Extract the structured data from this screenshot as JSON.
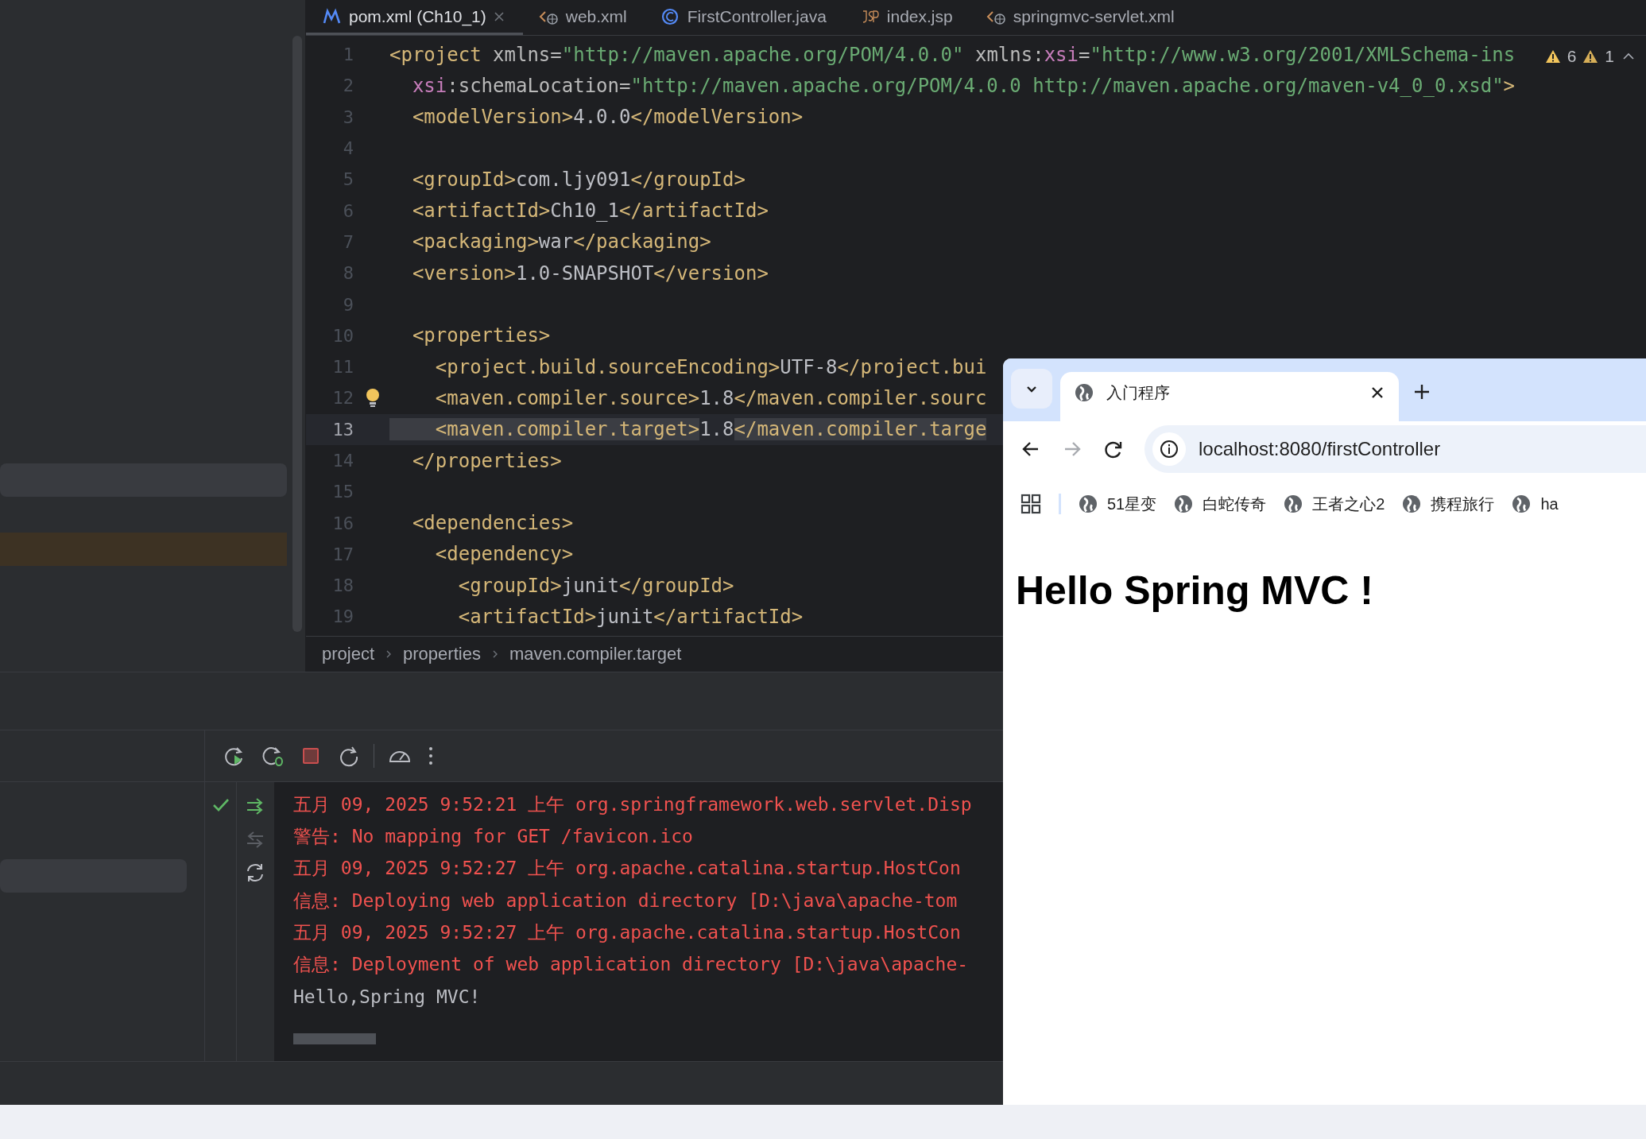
{
  "editor_tabs": [
    {
      "label": "pom.xml (Ch10_1)",
      "kind": "maven",
      "selected": true,
      "closable": true
    },
    {
      "label": "web.xml",
      "kind": "xml",
      "selected": false,
      "closable": false
    },
    {
      "label": "FirstController.java",
      "kind": "java",
      "selected": false,
      "closable": false
    },
    {
      "label": "index.jsp",
      "kind": "jsp",
      "selected": false,
      "closable": false
    },
    {
      "label": "springmvc-servlet.xml",
      "kind": "xml",
      "selected": false,
      "closable": false
    }
  ],
  "inspection": {
    "warnings": "6",
    "weak_warnings": "1"
  },
  "code_lines": [
    {
      "number": "1",
      "current": false,
      "bulb": false,
      "tokens": [
        {
          "kind": "tag",
          "text": "<project "
        },
        {
          "kind": "attr",
          "text": "xmlns="
        },
        {
          "kind": "str",
          "text": "\"http://maven.apache.org/POM/4.0.0\""
        },
        {
          "kind": "attr",
          "text": " xmlns:"
        },
        {
          "kind": "ns",
          "text": "xsi"
        },
        {
          "kind": "attr",
          "text": "="
        },
        {
          "kind": "str",
          "text": "\"http://www.w3.org/2001/XMLSchema-ins"
        }
      ]
    },
    {
      "number": "2",
      "current": false,
      "bulb": false,
      "tokens": [
        {
          "kind": "ns",
          "text": "  xsi"
        },
        {
          "kind": "attr",
          "text": ":schemaLocation="
        },
        {
          "kind": "str",
          "text": "\"http://maven.apache.org/POM/4.0.0 http://maven.apache.org/maven-v4_0_0.xsd\""
        },
        {
          "kind": "tag",
          "text": ">"
        }
      ]
    },
    {
      "number": "3",
      "current": false,
      "bulb": false,
      "tokens": [
        {
          "kind": "tag",
          "text": "  <modelVersion>"
        },
        {
          "kind": "text",
          "text": "4.0.0"
        },
        {
          "kind": "tag",
          "text": "</modelVersion>"
        }
      ]
    },
    {
      "number": "4",
      "current": false,
      "bulb": false
    },
    {
      "number": "5",
      "current": false,
      "bulb": false,
      "tokens": [
        {
          "kind": "tag",
          "text": "  <groupId>"
        },
        {
          "kind": "text",
          "text": "com.ljy091"
        },
        {
          "kind": "tag",
          "text": "</groupId>"
        }
      ]
    },
    {
      "number": "6",
      "current": false,
      "bulb": false,
      "tokens": [
        {
          "kind": "tag",
          "text": "  <artifactId>"
        },
        {
          "kind": "text",
          "text": "Ch10_1"
        },
        {
          "kind": "tag",
          "text": "</artifactId>"
        }
      ]
    },
    {
      "number": "7",
      "current": false,
      "bulb": false,
      "tokens": [
        {
          "kind": "tag",
          "text": "  <packaging>"
        },
        {
          "kind": "text",
          "text": "war"
        },
        {
          "kind": "tag",
          "text": "</packaging>"
        }
      ]
    },
    {
      "number": "8",
      "current": false,
      "bulb": false,
      "tokens": [
        {
          "kind": "tag",
          "text": "  <version>"
        },
        {
          "kind": "text",
          "text": "1.0-SNAPSHOT"
        },
        {
          "kind": "tag",
          "text": "</version>"
        }
      ]
    },
    {
      "number": "9",
      "current": false,
      "bulb": false
    },
    {
      "number": "10",
      "current": false,
      "bulb": false,
      "tokens": [
        {
          "kind": "tag",
          "text": "  <properties>"
        }
      ]
    },
    {
      "number": "11",
      "current": false,
      "bulb": false,
      "tokens": [
        {
          "kind": "tag",
          "text": "    <project.build.sourceEncoding>"
        },
        {
          "kind": "text",
          "text": "UTF-8"
        },
        {
          "kind": "tag",
          "text": "</project.bui"
        }
      ]
    },
    {
      "number": "12",
      "current": false,
      "bulb": true,
      "tokens": [
        {
          "kind": "tag",
          "text": "    <maven.compiler.source>"
        },
        {
          "kind": "text",
          "text": "1.8"
        },
        {
          "kind": "tag",
          "text": "</maven.compiler.sourc"
        }
      ]
    },
    {
      "number": "13",
      "current": true,
      "bulb": false,
      "tokens": [
        {
          "kind": "tag-match",
          "text": "    <maven.compiler.target>"
        },
        {
          "kind": "text",
          "text": "1.8"
        },
        {
          "kind": "tag-match",
          "text": "</maven.compiler.targe"
        }
      ]
    },
    {
      "number": "14",
      "current": false,
      "bulb": false,
      "tokens": [
        {
          "kind": "tag",
          "text": "  </properties>"
        }
      ]
    },
    {
      "number": "15",
      "current": false,
      "bulb": false
    },
    {
      "number": "16",
      "current": false,
      "bulb": false,
      "tokens": [
        {
          "kind": "tag",
          "text": "  <dependencies>"
        }
      ]
    },
    {
      "number": "17",
      "current": false,
      "bulb": false,
      "tokens": [
        {
          "kind": "tag",
          "text": "    <dependency>"
        }
      ]
    },
    {
      "number": "18",
      "current": false,
      "bulb": false,
      "tokens": [
        {
          "kind": "tag",
          "text": "      <groupId>"
        },
        {
          "kind": "text",
          "text": "junit"
        },
        {
          "kind": "tag",
          "text": "</groupId>"
        }
      ]
    },
    {
      "number": "19",
      "current": false,
      "bulb": false,
      "tokens": [
        {
          "kind": "tag",
          "text": "      <artifactId>"
        },
        {
          "kind": "text",
          "text": "junit"
        },
        {
          "kind": "tag",
          "text": "</artifactId>"
        }
      ]
    }
  ],
  "breadcrumbs": [
    "project",
    "properties",
    "maven.compiler.target"
  ],
  "console_lines": [
    {
      "kind": "stderr",
      "text": "五月 09, 2025 9:52:21 上午 org.springframework.web.servlet.Disp"
    },
    {
      "kind": "stderr",
      "text": "警告: No mapping for GET /favicon.ico"
    },
    {
      "kind": "stderr",
      "text": "五月 09, 2025 9:52:27 上午 org.apache.catalina.startup.HostCon"
    },
    {
      "kind": "stderr",
      "text": "信息: Deploying web application directory [D:\\java\\apache-tom"
    },
    {
      "kind": "stderr",
      "text": "五月 09, 2025 9:52:27 上午 org.apache.catalina.startup.HostCon"
    },
    {
      "kind": "stderr",
      "text": "信息: Deployment of web application directory [D:\\java\\apache-"
    },
    {
      "kind": "stdout",
      "text": "Hello,Spring MVC!"
    }
  ],
  "browser": {
    "tabs": [
      {
        "title": "入门程序",
        "selected": true
      }
    ],
    "address": "localhost:8080/firstController",
    "bookmarks": [
      "51星变",
      "白蛇传奇",
      "王者之心2",
      "携程旅行",
      "ha"
    ],
    "page_heading": "Hello Spring MVC !"
  }
}
